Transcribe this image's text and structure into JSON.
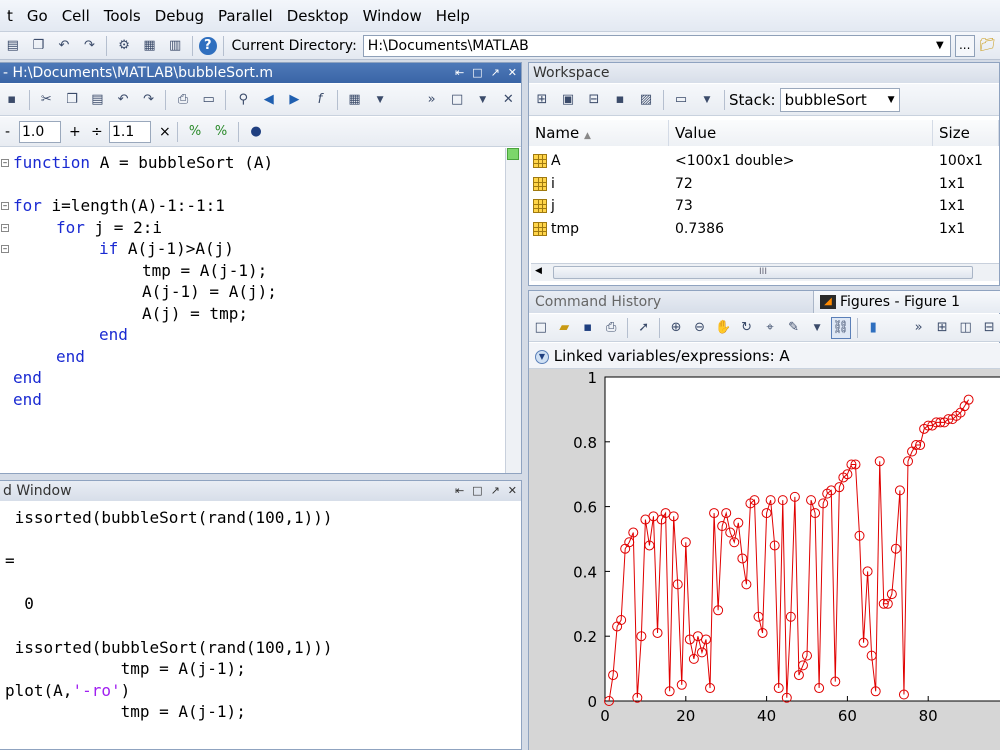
{
  "menu": [
    "t",
    "Go",
    "Cell",
    "Tools",
    "Debug",
    "Parallel",
    "Desktop",
    "Window",
    "Help"
  ],
  "toolbar": {
    "current_directory_label": "Current Directory:",
    "current_directory_value": "H:\\Documents\\MATLAB",
    "browse_label": "..."
  },
  "editor": {
    "title": "- H:\\Documents\\MATLAB\\bubbleSort.m",
    "cell_minus": "-",
    "cell_value1": "1.0",
    "cell_plus": "+",
    "cell_div": "÷",
    "cell_value2": "1.1",
    "cell_times": "×",
    "code": [
      {
        "text": "function A = bubbleSort (A)",
        "indent": 0
      },
      {
        "text": "",
        "indent": 0
      },
      {
        "text": "for i=length(A)-1:-1:1",
        "indent": 0
      },
      {
        "text": "for j = 2:i",
        "indent": 1
      },
      {
        "text": "if A(j-1)>A(j)",
        "indent": 2
      },
      {
        "text": "tmp = A(j-1);",
        "indent": 3
      },
      {
        "text": "A(j-1) = A(j);",
        "indent": 3
      },
      {
        "text": "A(j) = tmp;",
        "indent": 3
      },
      {
        "text": "end",
        "indent": 2
      },
      {
        "text": "end",
        "indent": 1
      },
      {
        "text": "end",
        "indent": 0
      },
      {
        "text": "end",
        "indent": 0
      }
    ]
  },
  "command_window": {
    "title": "d Window",
    "lines": [
      " issorted(bubbleSort(rand(100,1)))",
      "",
      "=",
      "",
      "  0",
      "",
      " issorted(bubbleSort(rand(100,1)))",
      "            tmp = A(j-1);",
      "plot(A,'-ro')",
      "            tmp = A(j-1);"
    ]
  },
  "workspace": {
    "title": "Workspace",
    "stack_label": "Stack:",
    "stack_value": "bubbleSort",
    "columns": [
      "Name",
      "Value",
      "Size"
    ],
    "rows": [
      {
        "name": "A",
        "value": "<100x1 double>",
        "size": "100x1"
      },
      {
        "name": "i",
        "value": "72",
        "size": "1x1"
      },
      {
        "name": "j",
        "value": "73",
        "size": "1x1"
      },
      {
        "name": "tmp",
        "value": "0.7386",
        "size": "1x1"
      }
    ],
    "scroll_grip": "III"
  },
  "figures": {
    "tab_history": "Command History",
    "tab_figures": "Figures - Figure 1",
    "linked_label": "Linked variables/expressions: A"
  },
  "chart_data": {
    "type": "line",
    "marker": "circle",
    "color": "#e00000",
    "xlim": [
      0,
      100
    ],
    "ylim": [
      0,
      1
    ],
    "xticks": [
      0,
      20,
      40,
      60,
      80
    ],
    "yticks": [
      0,
      0.2,
      0.4,
      0.6,
      0.8,
      1
    ],
    "x": [
      1,
      2,
      3,
      4,
      5,
      6,
      7,
      8,
      9,
      10,
      11,
      12,
      13,
      14,
      15,
      16,
      17,
      18,
      19,
      20,
      21,
      22,
      23,
      24,
      25,
      26,
      27,
      28,
      29,
      30,
      31,
      32,
      33,
      34,
      35,
      36,
      37,
      38,
      39,
      40,
      41,
      42,
      43,
      44,
      45,
      46,
      47,
      48,
      49,
      50,
      51,
      52,
      53,
      54,
      55,
      56,
      57,
      58,
      59,
      60,
      61,
      62,
      63,
      64,
      65,
      66,
      67,
      68,
      69,
      70,
      71,
      72,
      73,
      74,
      75,
      76,
      77,
      78,
      79,
      80,
      81,
      82,
      83,
      84,
      85,
      86,
      87,
      88,
      89,
      90
    ],
    "y": [
      0.0,
      0.08,
      0.23,
      0.25,
      0.47,
      0.49,
      0.52,
      0.01,
      0.2,
      0.56,
      0.48,
      0.57,
      0.21,
      0.56,
      0.58,
      0.03,
      0.57,
      0.36,
      0.05,
      0.49,
      0.19,
      0.13,
      0.2,
      0.15,
      0.19,
      0.04,
      0.58,
      0.28,
      0.54,
      0.58,
      0.52,
      0.49,
      0.55,
      0.44,
      0.36,
      0.61,
      0.62,
      0.26,
      0.21,
      0.58,
      0.62,
      0.48,
      0.04,
      0.62,
      0.01,
      0.26,
      0.63,
      0.08,
      0.11,
      0.14,
      0.62,
      0.58,
      0.04,
      0.61,
      0.64,
      0.65,
      0.06,
      0.66,
      0.69,
      0.7,
      0.73,
      0.73,
      0.51,
      0.18,
      0.4,
      0.14,
      0.03,
      0.74,
      0.3,
      0.3,
      0.33,
      0.47,
      0.65,
      0.02,
      0.74,
      0.77,
      0.79,
      0.79,
      0.84,
      0.85,
      0.85,
      0.86,
      0.86,
      0.86,
      0.87,
      0.87,
      0.88,
      0.89,
      0.91,
      0.93
    ]
  }
}
